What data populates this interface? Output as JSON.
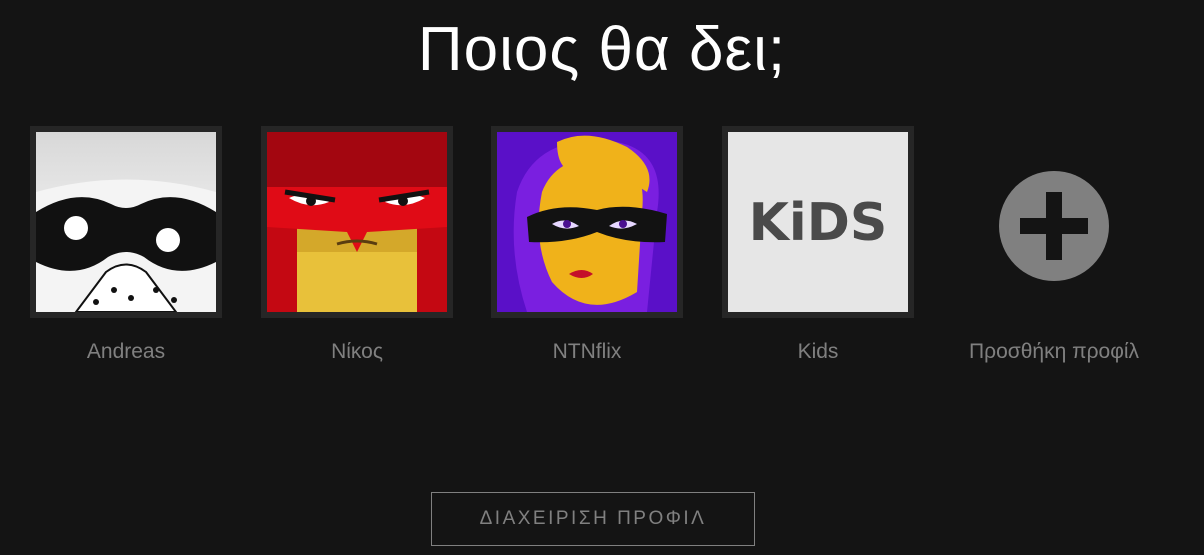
{
  "page_title": "Ποιος θα δει;",
  "profiles": [
    {
      "name": "Andreas",
      "avatar_icon": "white-masked-dog-avatar",
      "color": "#ffffff"
    },
    {
      "name": "Νίκος",
      "avatar_icon": "red-angry-hero-avatar",
      "color": "#e50914"
    },
    {
      "name": "NTNflix",
      "avatar_icon": "purple-masked-heroine-avatar",
      "color": "#6a1fd1"
    },
    {
      "name": "Kids",
      "avatar_icon": "kids-logo-avatar",
      "avatar_text": "KiDS",
      "color": "#e6e6e6"
    }
  ],
  "add_profile": {
    "label": "Προσθήκη προφίλ",
    "icon": "plus-circle-icon"
  },
  "manage_button": {
    "label": "ΔΙΑΧΕΙΡΙΣΗ ΠΡΟΦΙΛ"
  },
  "colors": {
    "background": "#141414",
    "muted_text": "#808080",
    "title_text": "#ffffff",
    "add_icon": "#808080"
  }
}
